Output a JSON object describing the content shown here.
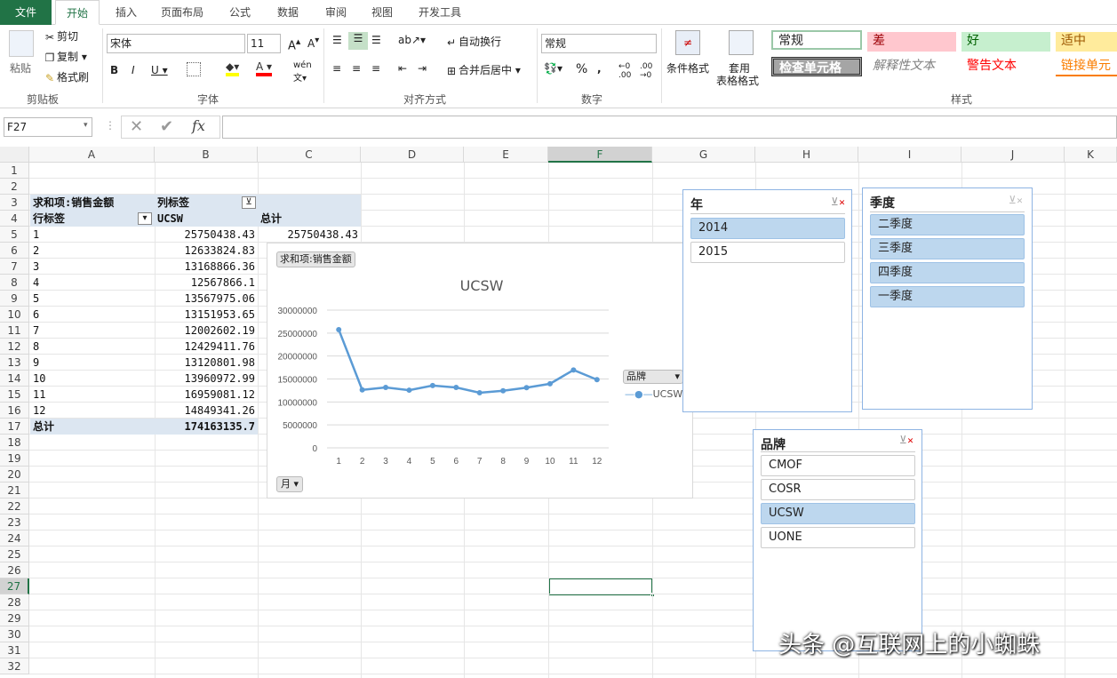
{
  "tabs": [
    "文件",
    "开始",
    "插入",
    "页面布局",
    "公式",
    "数据",
    "审阅",
    "视图",
    "开发工具"
  ],
  "ribbon": {
    "clipboard": {
      "paste": "粘贴",
      "cut": "剪切",
      "copy": "复制",
      "format_painter": "格式刷",
      "label": "剪贴板"
    },
    "font": {
      "name": "宋体",
      "size": "11",
      "label": "字体"
    },
    "align": {
      "wrap": "自动换行",
      "merge": "合并后居中",
      "label": "对齐方式"
    },
    "number": {
      "format": "常规",
      "label": "数字"
    },
    "styles": {
      "cond_format": "条件格式",
      "table_format_1": "套用",
      "table_format_2": "表格格式",
      "label": "样式",
      "cells": [
        {
          "text": "常规",
          "bg": "#ffffff"
        },
        {
          "text": "差",
          "bg": "#ffc7ce",
          "color": "#9c0006"
        },
        {
          "text": "好",
          "bg": "#c6efce",
          "color": "#006100"
        },
        {
          "text": "适中",
          "bg": "#ffeb9c",
          "color": "#9c5700"
        },
        {
          "text": "检查单元格",
          "bg": "#a5a5a5",
          "color": "#ffffff"
        },
        {
          "text": "解释性文本",
          "color": "#7f7f7f"
        },
        {
          "text": "警告文本",
          "color": "#ff0000"
        },
        {
          "text": "链接单元格",
          "color": "#fa7d00"
        }
      ]
    }
  },
  "formula_bar": {
    "name_box": "F27",
    "fx": "fx",
    "value": ""
  },
  "columns": [
    "A",
    "B",
    "C",
    "D",
    "E",
    "F",
    "G",
    "H",
    "I",
    "J",
    "K"
  ],
  "rows": [
    "1",
    "2",
    "3",
    "4",
    "5",
    "6",
    "7",
    "8",
    "9",
    "10",
    "11",
    "12",
    "13",
    "14",
    "15",
    "16",
    "17",
    "18",
    "19",
    "20",
    "21",
    "22",
    "23",
    "24",
    "25",
    "26",
    "27",
    "28",
    "29",
    "30",
    "31",
    "32"
  ],
  "pivot": {
    "sum_label": "求和项:销售金额",
    "col_label": "列标签",
    "row_label": "行标签",
    "col_value": "UCSW",
    "total_label": "总计",
    "first_total": "25750438.43",
    "rows": [
      [
        "1",
        "25750438.43"
      ],
      [
        "2",
        "12633824.83"
      ],
      [
        "3",
        "13168866.36"
      ],
      [
        "4",
        "12567866.1"
      ],
      [
        "5",
        "13567975.06"
      ],
      [
        "6",
        "13151953.65"
      ],
      [
        "7",
        "12002602.19"
      ],
      [
        "8",
        "12429411.76"
      ],
      [
        "9",
        "13120801.98"
      ],
      [
        "10",
        "13960972.99"
      ],
      [
        "11",
        "16959081.12"
      ],
      [
        "12",
        "14849341.26"
      ]
    ],
    "grand_total": "174163135.7"
  },
  "chart": {
    "field_button": "求和项:销售金额",
    "axis_button": "月",
    "legend_button": "品牌",
    "legend_series": "UCSW"
  },
  "chart_data": {
    "type": "line",
    "title": "UCSW",
    "categories": [
      "1",
      "2",
      "3",
      "4",
      "5",
      "6",
      "7",
      "8",
      "9",
      "10",
      "11",
      "12"
    ],
    "series": [
      {
        "name": "UCSW",
        "values": [
          25750438.43,
          12633824.83,
          13168866.36,
          12567866.1,
          13567975.06,
          13151953.65,
          12002602.19,
          12429411.76,
          13120801.98,
          13960972.99,
          16959081.12,
          14849341.26
        ]
      }
    ],
    "yticks": [
      "30000000",
      "25000000",
      "20000000",
      "15000000",
      "10000000",
      "5000000",
      "0"
    ],
    "ylim": [
      0,
      30000000
    ],
    "grid": true,
    "legend": "right",
    "color": "#5b9bd5"
  },
  "slicers": {
    "year": {
      "title": "年",
      "items": [
        {
          "text": "2014",
          "selected": true
        },
        {
          "text": "2015",
          "selected": false
        }
      ]
    },
    "quarter": {
      "title": "季度",
      "items": [
        {
          "text": "二季度",
          "selected": true
        },
        {
          "text": "三季度",
          "selected": true
        },
        {
          "text": "四季度",
          "selected": true
        },
        {
          "text": "一季度",
          "selected": true
        }
      ]
    },
    "brand": {
      "title": "品牌",
      "items": [
        {
          "text": "CMOF",
          "selected": false
        },
        {
          "text": "COSR",
          "selected": false
        },
        {
          "text": "UCSW",
          "selected": true
        },
        {
          "text": "UONE",
          "selected": false
        }
      ]
    }
  },
  "watermark": "头条 @互联网上的小蜘蛛"
}
